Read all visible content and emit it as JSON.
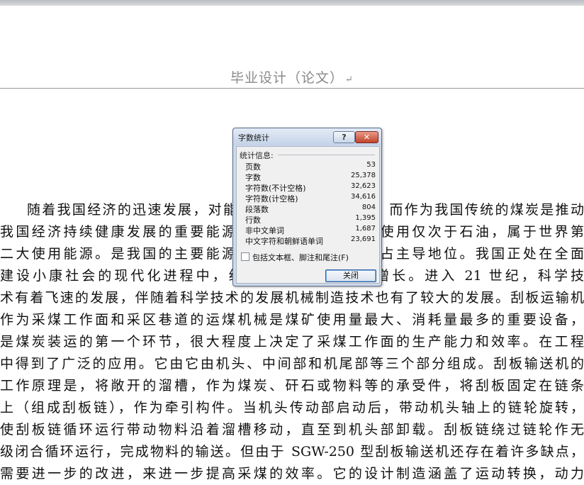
{
  "document": {
    "header_title": "毕业设计（论文）",
    "paragraph_mark": "↵",
    "lines": [
      "随着我国经济的迅速发展，对能源的需求量日益增加。而作为我国传统的煤炭是推动",
      "我国经济持续健康发展的重要能源保障，煤炭在世界的使用仅次于石油，属于世界第",
      "二大使用能源。是我国的主要能源，在能源消费结构中占主导地位。我国正处在全面",
      "建设小康社会的现代化进程中，经济社会正处于快速增长。进入 21 世纪，科学技",
      "术有着飞速的发展，伴随着科学技术的发展机械制造技术也有了较大的发展。刮板运输机",
      "作为采煤工作面和采区巷道的运煤机械是煤矿使用量最大、消耗量最多的重要设备，",
      "是煤炭装运的第一个环节，很大程度上决定了采煤工作面的生产能力和效率。在工程",
      "中得到了广泛的应用。它由它由机头、中间部和机尾部等三个部分组成。刮板输送机的",
      "工作原理是，将敞开的溜槽，作为煤炭、矸石或物料等的承受件，将刮板固定在链条",
      "上（组成刮板链），作为牵引构件。当机头传动部启动后，带动机头轴上的链轮旋转，",
      "使刮板链循环运行带动物料沿着溜槽移动，直至到机头部卸载。刮板链绕过链轮作无",
      "级闭合循环运行，完成物料的输送。但由于 SGW-250 型刮板输送机还存在着许多缺点，",
      "需要进一步的改进，来进一步提高采煤的效率。它的设计制造涵盖了运动转换，动力"
    ]
  },
  "dialog": {
    "title": "字数统计",
    "help_label": "?",
    "close_label": "✕",
    "section_label": "统计信息:",
    "stats": [
      {
        "label": "页数",
        "value": "53"
      },
      {
        "label": "字数",
        "value": "25,378"
      },
      {
        "label": "字符数(不计空格)",
        "value": "32,623"
      },
      {
        "label": "字符数(计空格)",
        "value": "34,616"
      },
      {
        "label": "段落数",
        "value": "804"
      },
      {
        "label": "行数",
        "value": "1,395"
      },
      {
        "label": "非中文单词",
        "value": "1,687"
      },
      {
        "label": "中文字符和朝鲜语单词",
        "value": "23,691"
      }
    ],
    "checkbox_label": "包括文本框、脚注和尾注(F)",
    "checkbox_checked": false,
    "ok_label": "关闭"
  }
}
